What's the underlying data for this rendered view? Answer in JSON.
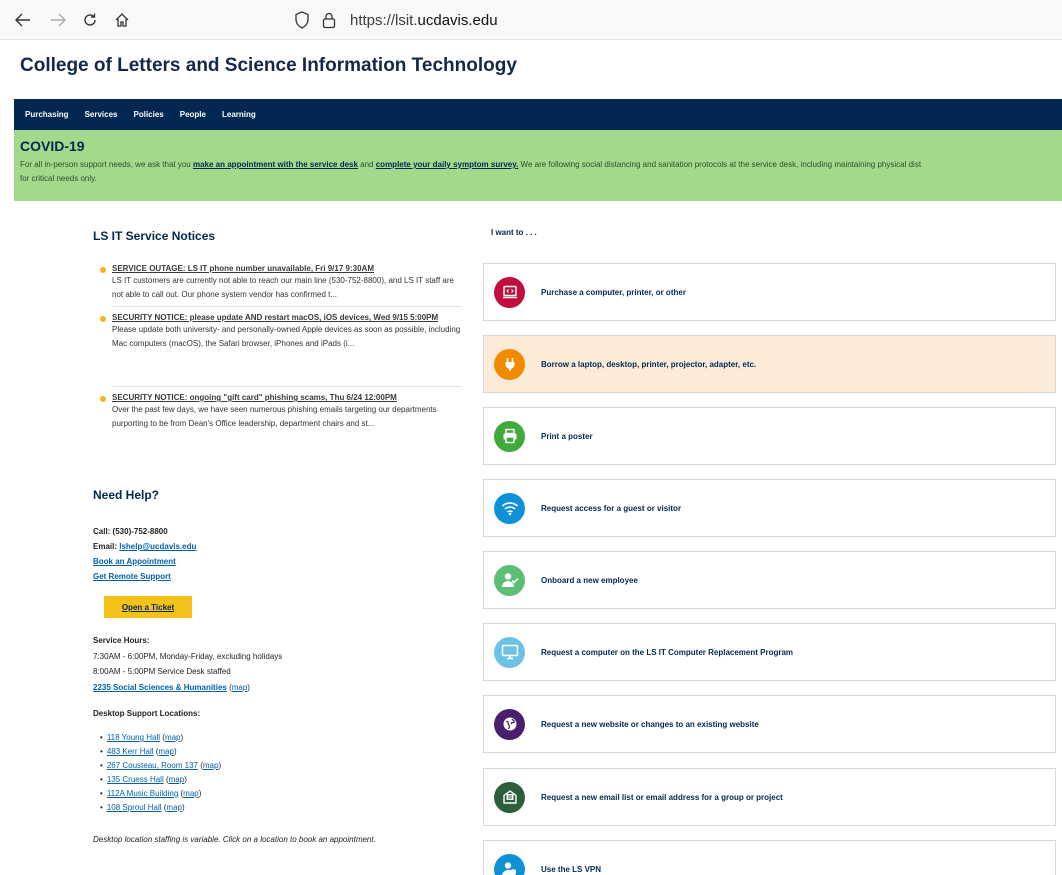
{
  "browser": {
    "url_prefix": "https://lsit.",
    "url_domain": "ucdavis.edu"
  },
  "site": {
    "title": "College of Letters and Science Information Technology"
  },
  "nav": [
    "Purchasing",
    "Services",
    "Policies",
    "People",
    "Learning"
  ],
  "covid": {
    "heading": "COVID-19",
    "text_1": "For all in-person support needs, we ask that you ",
    "link_1": "make an appointment with the service desk",
    "text_2": " and ",
    "link_2": "complete your daily symptom survey.",
    "text_3": "  We are following social distancing and sanitation protocols at the service desk, including maintaining physical dist",
    "line_2": "for critical needs only."
  },
  "notices": {
    "title": "LS IT Service Notices",
    "items": [
      {
        "heading": "SERVICE OUTAGE: LS IT phone number unavailable, Fri 9/17 9:30AM",
        "body": "LS IT customers are currently not able to reach our main line (530-752-8800), and LS IT staff are not able to call out. Our phone system vendor has confirmed t..."
      },
      {
        "heading": "SECURITY NOTICE: please update AND restart macOS, iOS devices, Wed 9/15 5:00PM",
        "body": "Please update both university- and personally-owned Apple devices as soon as possible, including Mac computers (macOS), the Safari browser, iPhones and iPads (i..."
      },
      {
        "heading": "SECURITY NOTICE: ongoing \"gift card\" phishing scams, Thu 6/24 12:00PM",
        "body": "Over the past few days, we have seen numerous phishing emails targeting our departments purporting to be from Dean's Office leadership, department chairs and st..."
      }
    ]
  },
  "help": {
    "title": "Need Help?",
    "call": "Call: (530)-752-8800",
    "email_label": "Email: ",
    "email": "lshelp@ucdavis.edu",
    "book": "Book an Appointment",
    "remote": "Get Remote Support",
    "ticket": "Open a Ticket",
    "hours_label": "Service Hours:",
    "hours_1": "7:30AM - 6:00PM, Monday-Friday, excluding holidays",
    "hours_2": "8:00AM - 5:00PM Service Desk staffed",
    "hq_location": "2235 Social Sciences & Humanities",
    "map": "map",
    "desktop_label": "Desktop Support Locations:",
    "locations": [
      "118 Young Hall",
      "483 Kerr Hall",
      "267 Cousteau, Room 137",
      "135 Cruess Hall",
      "112A Music Building",
      "108 Sproul Hall"
    ],
    "note": "Desktop location staffing is variable. Click on a location to book an appointment."
  },
  "iwant": {
    "title": "I want to . . .",
    "items": [
      {
        "label": "Purchase a computer, printer, or other",
        "icon": "purchase-icon",
        "color": "#c10e3c"
      },
      {
        "label": "Borrow a laptop, desktop, printer, projector, adapter, etc.",
        "icon": "plug-icon",
        "color": "#f18a00"
      },
      {
        "label": "Print a poster",
        "icon": "printer-icon",
        "color": "#3faa3a"
      },
      {
        "label": "Request access for a guest or visitor",
        "icon": "wifi-icon",
        "color": "#0f91d8"
      },
      {
        "label": "Onboard a new employee",
        "icon": "user-check-icon",
        "color": "#5cbf74"
      },
      {
        "label": "Request a computer on the LS IT Computer Replacement Program",
        "icon": "monitor-icon",
        "color": "#6cc2e6"
      },
      {
        "label": "Request a new website or changes to an existing website",
        "icon": "globe-icon",
        "color": "#4b1f6f"
      },
      {
        "label": "Request a new email list or email address for a group or project",
        "icon": "envelope-icon",
        "color": "#2d5e3c"
      },
      {
        "label": "Use the LS VPN",
        "icon": "vpn-user-icon",
        "color": "#0f91d8"
      }
    ]
  }
}
